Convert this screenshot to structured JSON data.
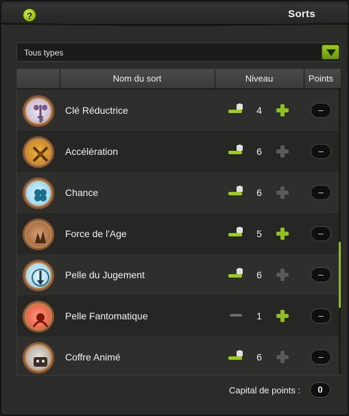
{
  "window": {
    "title": "Sorts",
    "help_label": "?"
  },
  "filter": {
    "selected": "Tous types"
  },
  "table": {
    "headers": {
      "name": "Nom du sort",
      "level": "Niveau",
      "points": "Points"
    },
    "rows": [
      {
        "name": "Clé Réductrice",
        "level": "4",
        "points": "–",
        "icon": "key-icon",
        "plus_enabled": true,
        "locked": true
      },
      {
        "name": "Accélération",
        "level": "6",
        "points": "–",
        "icon": "hourglass-icon",
        "plus_enabled": false,
        "locked": true
      },
      {
        "name": "Chance",
        "level": "6",
        "points": "–",
        "icon": "clover-icon",
        "plus_enabled": false,
        "locked": true
      },
      {
        "name": "Force de l'Age",
        "level": "5",
        "points": "–",
        "icon": "hand-icon",
        "plus_enabled": true,
        "locked": true
      },
      {
        "name": "Pelle du Jugement",
        "level": "6",
        "points": "–",
        "icon": "shovel-clock-icon",
        "plus_enabled": false,
        "locked": true
      },
      {
        "name": "Pelle Fantomatique",
        "level": "1",
        "points": "–",
        "icon": "ghost-shovel-icon",
        "plus_enabled": true,
        "locked": false
      },
      {
        "name": "Coffre Animé",
        "level": "6",
        "points": "–",
        "icon": "chest-icon",
        "plus_enabled": false,
        "locked": true
      }
    ]
  },
  "footer": {
    "capital_label": "Capital de points :",
    "capital_value": "0"
  },
  "colors": {
    "accent": "#8fbf1a",
    "plus_disabled": "#5a5a58",
    "background": "#2b2b2a"
  }
}
